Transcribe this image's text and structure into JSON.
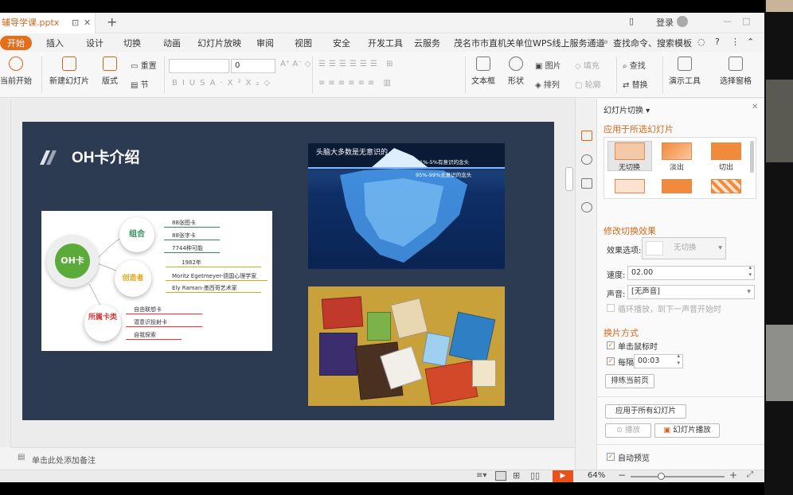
{
  "window": {
    "doc_tab": "辅导学课.pptx",
    "login": "登录"
  },
  "menu": {
    "tabs": [
      "开始",
      "插入",
      "设计",
      "切换",
      "动画",
      "幻灯片放映",
      "审阅",
      "视图",
      "安全",
      "开发工具",
      "云服务",
      "茂名市市直机关单位WPS线上服务通道"
    ],
    "search": "查找命令、搜索模板"
  },
  "ribbon": {
    "from_current": "当前开始",
    "new_slide": "新建幻灯片",
    "layout": "版式",
    "reset": "重置",
    "section": "节",
    "font_size": "0",
    "textbox": "文本框",
    "shape": "形状",
    "arrange": "排列",
    "picture": "图片",
    "fill": "填充",
    "outline": "轮廓",
    "find": "查找",
    "replace": "替换",
    "presenter": "演示工具",
    "selection_pane": "选择窗格"
  },
  "slide": {
    "title": "OH卡介绍",
    "diagram": {
      "center": "OH卡",
      "nodes": [
        "组合",
        "创造者",
        "所属卡类"
      ],
      "group_items": [
        "88张图卡",
        "88张字卡",
        "7744种可能"
      ],
      "creator_items": [
        "1982年",
        "Moritz Egetmeyer-德国心理学家",
        "Ely Raman-墨西哥艺术家"
      ],
      "category_items": [
        "自由联想卡",
        "潜意识投射卡",
        "自我探索"
      ]
    },
    "img1": {
      "caption": "头脑大多数是无意识的",
      "line1": "1%-5%有意识的念头",
      "line2": "95%-99%无意识的念头"
    }
  },
  "pane": {
    "title": "幻灯片切换",
    "apply_selected": "应用于所选幻灯片",
    "transitions": [
      "无切换",
      "淡出",
      "切出"
    ],
    "modify": "修改切换效果",
    "effect_label": "效果选项:",
    "effect_value": "无切换",
    "speed_label": "速度:",
    "speed_value": "02.00",
    "sound_label": "声音:",
    "sound_value": "[无声音]",
    "loop": "循环播放，到下一声音开始时",
    "advance": "换片方式",
    "on_click": "单击鼠标时",
    "every": "每隔",
    "every_value": "00:03",
    "rehearse": "排练当前页",
    "apply_all": "应用于所有幻灯片",
    "play": "播放",
    "slideshow": "幻灯片播放",
    "autopreview": "自动预览"
  },
  "notes": {
    "placeholder": "单击此处添加备注"
  },
  "status": {
    "zoom": "64%"
  },
  "colors": {
    "accent": "#e36e1d",
    "slide_bg": "#2c3a52",
    "green": "#5aab3a"
  }
}
